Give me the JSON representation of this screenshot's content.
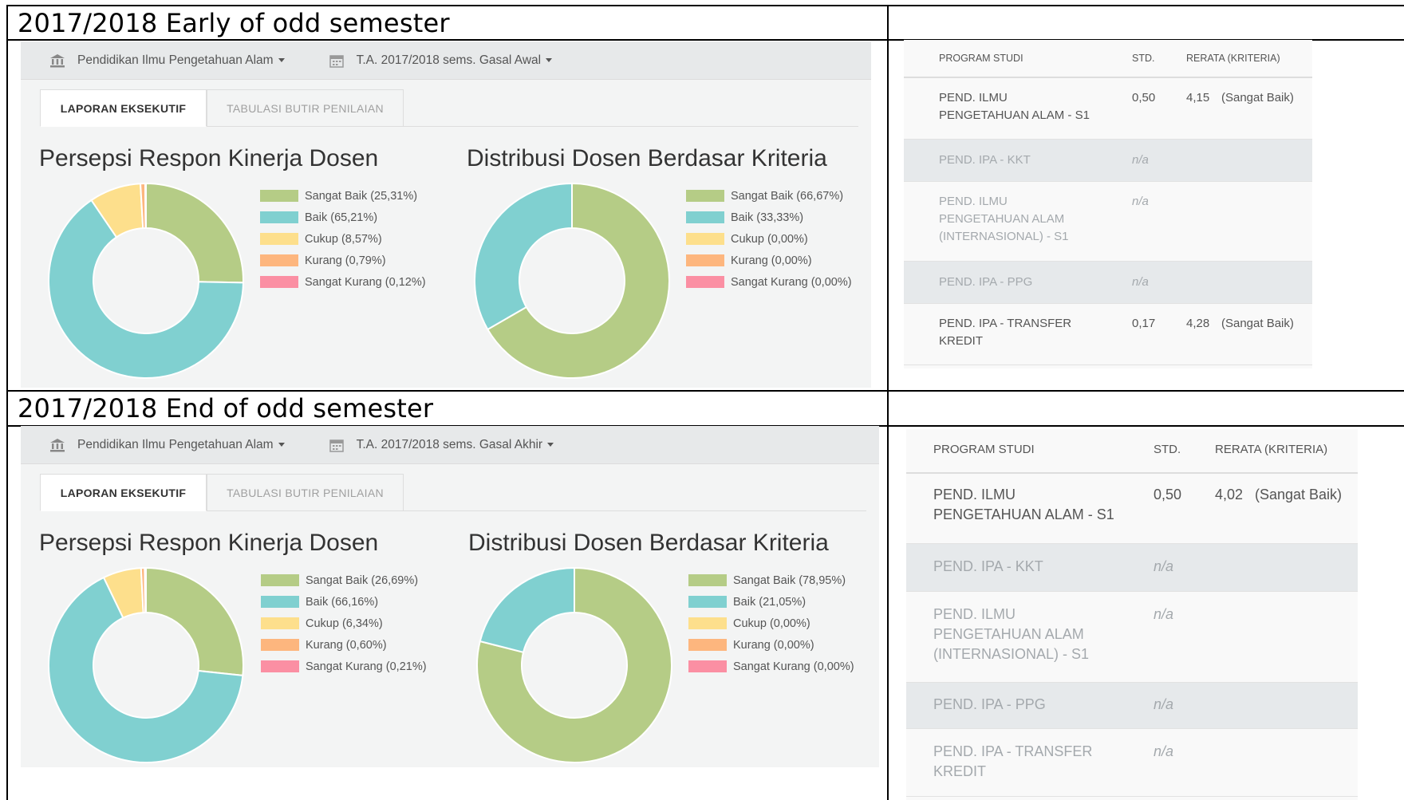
{
  "sections": [
    {
      "title": "2017/2018 Early of odd semester",
      "header": {
        "institution": "Pendidikan Ilmu Pengetahuan Alam",
        "period": "T.A. 2017/2018 sems. Gasal Awal"
      },
      "tabs": [
        "LAPORAN EKSEKUTIF",
        "TABULASI BUTIR PENILAIAN"
      ],
      "charts": [
        {
          "title": "Persepsi Respon Kinerja Dosen",
          "legend": [
            "Sangat Baik (25,31%)",
            "Baik (65,21%)",
            "Cukup (8,57%)",
            "Kurang (0,79%)",
            "Sangat Kurang (0,12%)"
          ]
        },
        {
          "title": "Distribusi Dosen Berdasar Kriteria",
          "legend": [
            "Sangat Baik (66,67%)",
            "Baik (33,33%)",
            "Cukup (0,00%)",
            "Kurang (0,00%)",
            "Sangat Kurang (0,00%)"
          ]
        }
      ],
      "table": {
        "headers": [
          "PROGRAM STUDI",
          "STD.",
          "RERATA (KRITERIA)"
        ],
        "rows": [
          {
            "program": [
              "PEND. ILMU",
              "PENGETAHUAN ALAM - S1"
            ],
            "std": "0,50",
            "rerata": "4,15",
            "kriteria": "(Sangat Baik)"
          },
          {
            "program": [
              "PEND. IPA - KKT"
            ],
            "std": "n/a",
            "rerata": "",
            "kriteria": ""
          },
          {
            "program": [
              "PEND. ILMU",
              "PENGETAHUAN ALAM",
              "(INTERNASIONAL) - S1"
            ],
            "std": "n/a",
            "rerata": "",
            "kriteria": ""
          },
          {
            "program": [
              "PEND. IPA - PPG"
            ],
            "std": "n/a",
            "rerata": "",
            "kriteria": ""
          },
          {
            "program": [
              "PEND. IPA - TRANSFER",
              "KREDIT"
            ],
            "std": "0,17",
            "rerata": "4,28",
            "kriteria": "(Sangat Baik)"
          }
        ]
      }
    },
    {
      "title": "2017/2018 End of odd semester",
      "header": {
        "institution": "Pendidikan Ilmu Pengetahuan Alam",
        "period": "T.A. 2017/2018 sems. Gasal Akhir"
      },
      "tabs": [
        "LAPORAN EKSEKUTIF",
        "TABULASI BUTIR PENILAIAN"
      ],
      "charts": [
        {
          "title": "Persepsi Respon Kinerja Dosen",
          "legend": [
            "Sangat Baik (26,69%)",
            "Baik (66,16%)",
            "Cukup (6,34%)",
            "Kurang (0,60%)",
            "Sangat Kurang (0,21%)"
          ]
        },
        {
          "title": "Distribusi Dosen Berdasar Kriteria",
          "legend": [
            "Sangat Baik (78,95%)",
            "Baik (21,05%)",
            "Cukup (0,00%)",
            "Kurang (0,00%)",
            "Sangat Kurang (0,00%)"
          ]
        }
      ],
      "table": {
        "headers": [
          "PROGRAM STUDI",
          "STD.",
          "RERATA (KRITERIA)"
        ],
        "rows": [
          {
            "program": [
              "PEND. ILMU",
              "PENGETAHUAN ALAM - S1"
            ],
            "std": "0,50",
            "rerata": "4,02",
            "kriteria": "(Sangat Baik)"
          },
          {
            "program": [
              "PEND. IPA - KKT"
            ],
            "std": "n/a",
            "rerata": "",
            "kriteria": ""
          },
          {
            "program": [
              "PEND. ILMU",
              "PENGETAHUAN ALAM",
              "(INTERNASIONAL) - S1"
            ],
            "std": "n/a",
            "rerata": "",
            "kriteria": ""
          },
          {
            "program": [
              "PEND. IPA - PPG"
            ],
            "std": "n/a",
            "rerata": "",
            "kriteria": ""
          },
          {
            "program": [
              "PEND. IPA - TRANSFER",
              "KREDIT"
            ],
            "std": "n/a",
            "rerata": "",
            "kriteria": ""
          }
        ]
      }
    }
  ],
  "colors": {
    "sangat_baik": "#b5cc86",
    "baik": "#80d0d0",
    "cukup": "#fddf8c",
    "kurang": "#fdb67e",
    "sangat_kurang": "#fb8fa3"
  },
  "chart_data": [
    {
      "type": "pie",
      "title": "Persepsi Respon Kinerja Dosen",
      "categories": [
        "Sangat Baik",
        "Baik",
        "Cukup",
        "Kurang",
        "Sangat Kurang"
      ],
      "values": [
        25.31,
        65.21,
        8.57,
        0.79,
        0.12
      ],
      "legend_position": "right"
    },
    {
      "type": "pie",
      "title": "Distribusi Dosen Berdasar Kriteria",
      "categories": [
        "Sangat Baik",
        "Baik",
        "Cukup",
        "Kurang",
        "Sangat Kurang"
      ],
      "values": [
        66.67,
        33.33,
        0.0,
        0.0,
        0.0
      ],
      "legend_position": "right"
    },
    {
      "type": "pie",
      "title": "Persepsi Respon Kinerja Dosen",
      "categories": [
        "Sangat Baik",
        "Baik",
        "Cukup",
        "Kurang",
        "Sangat Kurang"
      ],
      "values": [
        26.69,
        66.16,
        6.34,
        0.6,
        0.21
      ],
      "legend_position": "right"
    },
    {
      "type": "pie",
      "title": "Distribusi Dosen Berdasar Kriteria",
      "categories": [
        "Sangat Baik",
        "Baik",
        "Cukup",
        "Kurang",
        "Sangat Kurang"
      ],
      "values": [
        78.95,
        21.05,
        0.0,
        0.0,
        0.0
      ],
      "legend_position": "right"
    }
  ]
}
